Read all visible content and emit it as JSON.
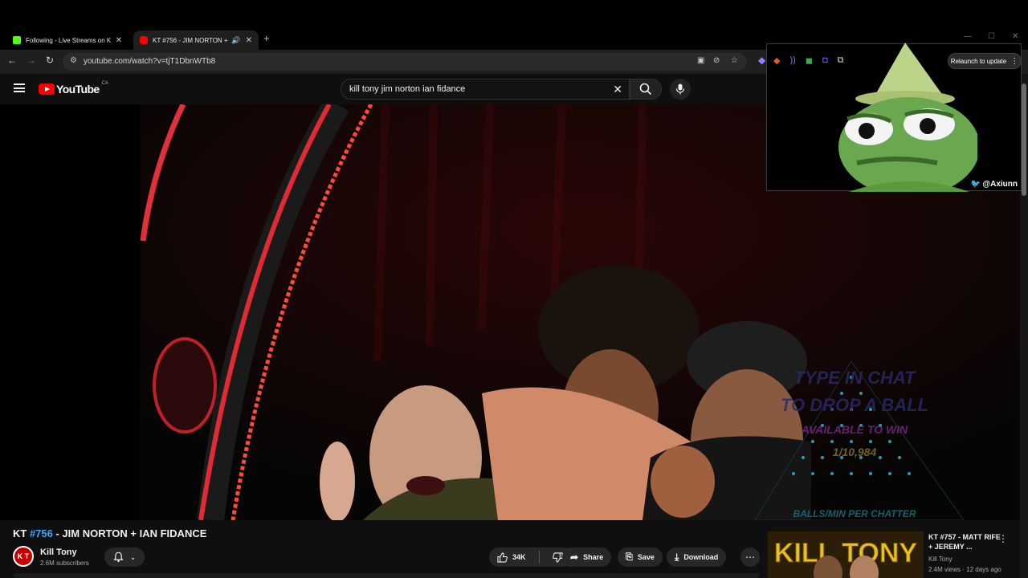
{
  "browser": {
    "tabs": [
      {
        "title": "Following - Live Streams on Kick",
        "favicon_color": "#53fc18"
      },
      {
        "title": "KT #756 - JIM NORTON + IAN FIDANCE",
        "favicon_color": "#ff0000"
      }
    ],
    "url": "youtube.com/watch?v=tjT1DbnWTb8",
    "relaunch_label": "Relaunch to update"
  },
  "youtube": {
    "region": "CA",
    "search_query": "kill tony jim norton ian fidance"
  },
  "overlay": {
    "handle": "@Axiunn"
  },
  "video_overlay": {
    "line1": "TYPE IN CHAT",
    "line2": "TO DROP A BALL",
    "line3": "AVAILABLE TO WIN",
    "count": "1/10,984",
    "footer": "BALLS/MIN PER CHATTER"
  },
  "video": {
    "title_prefix": "KT ",
    "title_hash": "#756",
    "title_rest": " - JIM NORTON + IAN FIDANCE",
    "channel": "Kill Tony",
    "channel_initials": "K T",
    "subscribers": "2.6M subscribers",
    "likes": "34K",
    "share_label": "Share",
    "save_label": "Save",
    "download_label": "Download"
  },
  "recommendation": {
    "thumb_text": "KILL TONY",
    "title": "KT #757 - MATT RIFE + JEREMY ...",
    "channel": "Kill Tony",
    "meta": "2.4M views · 12 days ago"
  },
  "colors": {
    "youtube_red": "#ff0000",
    "link_blue": "#3ea6ff",
    "background": "#0f0f0f"
  }
}
